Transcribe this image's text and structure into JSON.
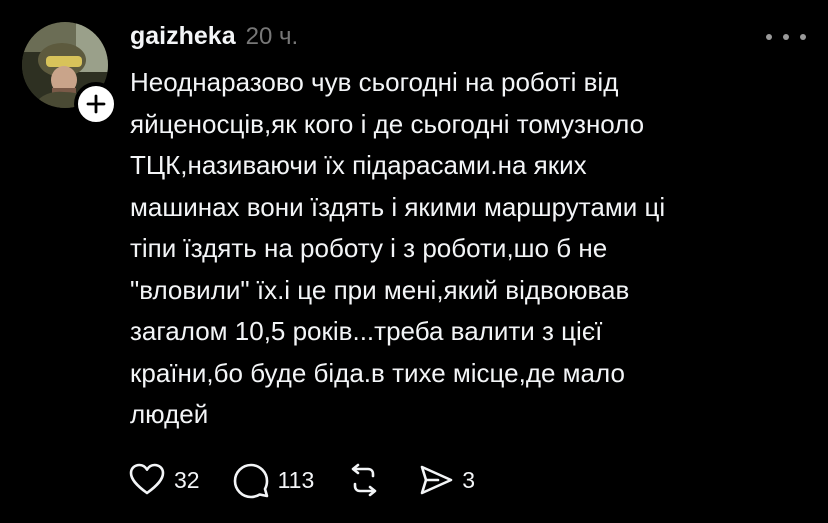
{
  "post": {
    "username": "gaizheka",
    "timestamp": "20 ч.",
    "text": "Неоднаразово чув сьогодні на роботі від\nяйценосців,як кого і де сьогодні томузноло\nТЦК,називаючи їх підарасами.на яких\nмашинах вони їздять і якими маршрутами ці\nтіпи їздять на роботу і з роботи,шо б не\n\"вловили\" їх.і це при мені,який відвоював\nзагалом 10,5 років...треба валити з цієї\nкраїни,бо буде біда.в тихе місце,де мало\nлюдей"
  },
  "actions": {
    "likes": "32",
    "replies": "113",
    "shares": "3"
  },
  "icons": {
    "avatar": "avatar-photo",
    "follow": "plus-icon",
    "more": "more-icon",
    "like": "heart-icon",
    "reply": "comment-icon",
    "repost": "repost-icon",
    "share": "send-icon"
  },
  "colors": {
    "background": "#000000",
    "text": "#f3f5f7",
    "muted": "#777777"
  }
}
